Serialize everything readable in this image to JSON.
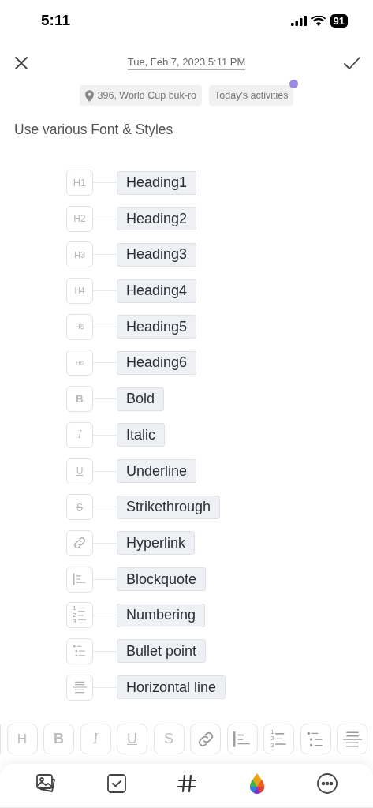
{
  "status_bar": {
    "time": "5:11",
    "battery": "91"
  },
  "header": {
    "date": "Tue, Feb 7, 2023 5:11 PM"
  },
  "tags": [
    {
      "kind": "location",
      "label": "396, World Cup buk-ro",
      "dot": false
    },
    {
      "kind": "plain",
      "label": "Today's activities",
      "dot": true
    }
  ],
  "note": {
    "text": "Use various Font & Styles"
  },
  "styles": [
    {
      "kind": "h1",
      "glyph": "H1",
      "label": "Heading1"
    },
    {
      "kind": "h2",
      "glyph": "H2",
      "label": "Heading2"
    },
    {
      "kind": "h3",
      "glyph": "H3",
      "label": "Heading3"
    },
    {
      "kind": "h4",
      "glyph": "H4",
      "label": "Heading4"
    },
    {
      "kind": "h5",
      "glyph": "H5",
      "label": "Heading5"
    },
    {
      "kind": "h6",
      "glyph": "H6",
      "label": "Heading6"
    },
    {
      "kind": "bold",
      "glyph": "B",
      "label": "Bold"
    },
    {
      "kind": "italic",
      "glyph": "I",
      "label": "Italic"
    },
    {
      "kind": "underline",
      "glyph": "U",
      "label": "Underline"
    },
    {
      "kind": "strike",
      "glyph": "S",
      "label": "Strikethrough"
    },
    {
      "kind": "link",
      "label": "Hyperlink"
    },
    {
      "kind": "quote",
      "label": "Blockquote"
    },
    {
      "kind": "numbering",
      "digits": [
        "1",
        "2",
        "3"
      ],
      "label": "Numbering"
    },
    {
      "kind": "bullet",
      "label": "Bullet point"
    },
    {
      "kind": "rule",
      "label": "Horizontal line"
    }
  ],
  "toolbar": [
    {
      "kind": "partial"
    },
    {
      "kind": "heading",
      "glyph": "H"
    },
    {
      "kind": "bold",
      "glyph": "B"
    },
    {
      "kind": "italic",
      "glyph": "I"
    },
    {
      "kind": "underline",
      "glyph": "U"
    },
    {
      "kind": "strike",
      "glyph": "S"
    },
    {
      "kind": "link"
    },
    {
      "kind": "quote"
    },
    {
      "kind": "numbering",
      "digits": [
        "1",
        "2",
        "3"
      ]
    },
    {
      "kind": "bullet"
    },
    {
      "kind": "rule"
    }
  ]
}
